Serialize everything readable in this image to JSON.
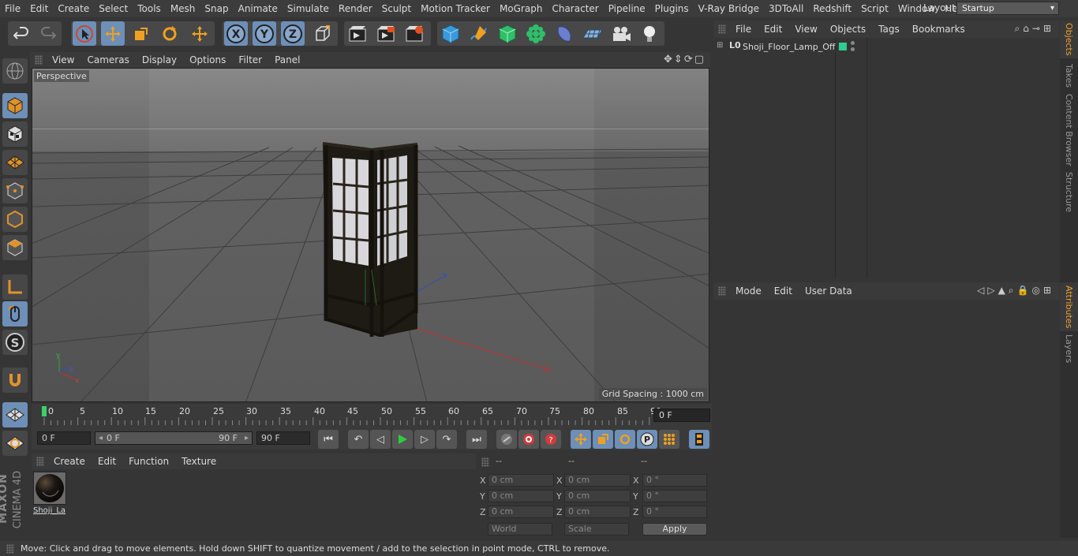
{
  "menubar": {
    "items": [
      "File",
      "Edit",
      "Create",
      "Select",
      "Tools",
      "Mesh",
      "Snap",
      "Animate",
      "Simulate",
      "Render",
      "Sculpt",
      "Motion Tracker",
      "MoGraph",
      "Character",
      "Pipeline",
      "Plugins",
      "V-Ray Bridge",
      "3DToAll",
      "Redshift",
      "Script",
      "Window",
      "Help"
    ],
    "layout_label": "Layout:",
    "layout_value": "Startup"
  },
  "viewport": {
    "menu": [
      "View",
      "Cameras",
      "Display",
      "Options",
      "Filter",
      "Panel"
    ],
    "camera_label": "Perspective",
    "grid_spacing": "Grid Spacing : 1000 cm"
  },
  "timeline": {
    "ticks": [
      "0",
      "5",
      "10",
      "15",
      "20",
      "25",
      "30",
      "35",
      "40",
      "45",
      "50",
      "55",
      "60",
      "65",
      "70",
      "75",
      "80",
      "85",
      "90"
    ],
    "current_frame": "0 F"
  },
  "transport": {
    "start_field": "0 F",
    "range_start": "0 F",
    "range_end": "90 F",
    "end_field": "90 F"
  },
  "materials": {
    "menu": [
      "Create",
      "Edit",
      "Function",
      "Texture"
    ],
    "items": [
      {
        "name": "Shoji_La"
      }
    ]
  },
  "coordinates": {
    "headers": [
      "--",
      "--",
      "--"
    ],
    "rows": [
      {
        "axis": "X",
        "pos": "0 cm",
        "size_axis": "X",
        "size": "0 cm",
        "rot_axis": "X",
        "rot": "0 °"
      },
      {
        "axis": "Y",
        "pos": "0 cm",
        "size_axis": "Y",
        "size": "0 cm",
        "rot_axis": "Y",
        "rot": "0 °"
      },
      {
        "axis": "Z",
        "pos": "0 cm",
        "size_axis": "Z",
        "size": "0 cm",
        "rot_axis": "Z",
        "rot": "0 °"
      }
    ],
    "world": "World",
    "scale": "Scale",
    "apply": "Apply"
  },
  "objects": {
    "menu": [
      "File",
      "Edit",
      "View",
      "Objects",
      "Tags",
      "Bookmarks"
    ],
    "items": [
      {
        "name": "Shoji_Floor_Lamp_Off",
        "color": "#2ecc8f"
      }
    ]
  },
  "attributes": {
    "menu": [
      "Mode",
      "Edit",
      "User Data"
    ]
  },
  "side_tabs": [
    "Objects",
    "Takes",
    "Content Browser",
    "Structure",
    "Attributes",
    "Layers"
  ],
  "status": "Move: Click and drag to move elements. Hold down SHIFT to quantize movement / add to the selection in point mode, CTRL to remove.",
  "brand": {
    "line1": "MAXON",
    "line2": "CINEMA 4D"
  },
  "colors": {
    "accent": "#6d8fb8",
    "play": "#2ecc40",
    "record": "#d23c3c",
    "tab_active": "#f0a030"
  }
}
